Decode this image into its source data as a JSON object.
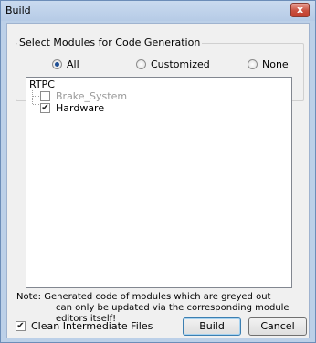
{
  "window": {
    "title": "Build",
    "close_label": "x"
  },
  "group": {
    "legend": "Select Modules for Code Generation",
    "radios": [
      {
        "label": "All",
        "checked": true
      },
      {
        "label": "Customized",
        "checked": false
      },
      {
        "label": "None",
        "checked": false
      }
    ]
  },
  "tree": {
    "root": "RTPC",
    "items": [
      {
        "label": "Brake_System",
        "checked": false,
        "disabled": true
      },
      {
        "label": "Hardware",
        "checked": true,
        "disabled": false
      }
    ]
  },
  "note": {
    "line1": "Note: Generated code of modules which are greyed out",
    "line2": "can only be updated via the corresponding module editors itself!"
  },
  "footer": {
    "clean_label": "Clean Intermediate Files",
    "clean_checked": true,
    "build_label": "Build",
    "cancel_label": "Cancel"
  }
}
